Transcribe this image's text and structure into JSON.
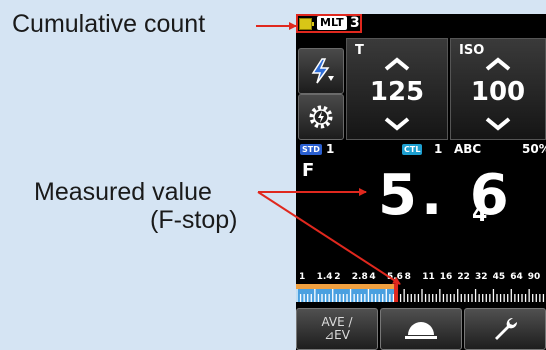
{
  "callouts": {
    "cumulative": "Cumulative count",
    "measured_line1": "Measured value",
    "measured_line2": "(F-stop)"
  },
  "status": {
    "mode_badge": "MLT",
    "count": "3",
    "battery_color": "#d8c616"
  },
  "panels": {
    "t_label": "T",
    "t_value": "125",
    "iso_label": "ISO",
    "iso_value": "100"
  },
  "info": {
    "std_tag": "STD",
    "std_value": "1",
    "ctl_tag": "CTL",
    "ctl_value": "1",
    "ctl_group": "ABC",
    "ctl_percent": "50%"
  },
  "measurement": {
    "label": "F",
    "main": "5. 6",
    "sub": "4"
  },
  "scale": {
    "ticks": [
      "1",
      "1.4",
      "2",
      "2.8",
      "4",
      "5.6",
      "8",
      "11",
      "16",
      "22",
      "32",
      "45",
      "64",
      "90"
    ],
    "measured_index": 5.4
  },
  "buttons": {
    "ave_line1": "AVE /",
    "ave_line2": "⊿EV"
  },
  "colors": {
    "callout_red": "#e0281e",
    "scale_orange": "#f0a040",
    "scale_blue": "#4aa0e0",
    "tag_std": "#2a5fd0",
    "tag_ctl": "#1d9fd0"
  },
  "icons": {
    "flash_button": "flash-icon",
    "settings_button": "flash-gear-icon",
    "mode_button": "dome-icon",
    "tool_button": "wrench-icon"
  }
}
